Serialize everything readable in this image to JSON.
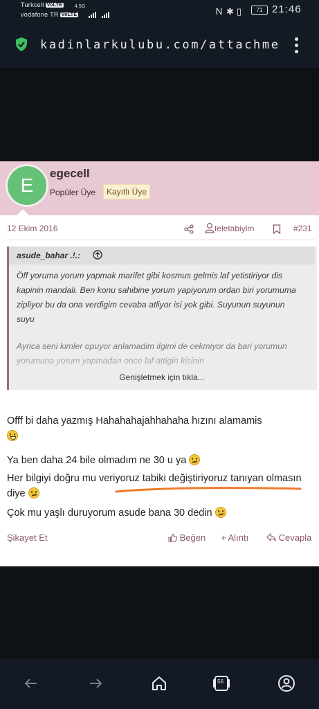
{
  "status_bar": {
    "carrier1": "Turkcell",
    "carrier2": "vodafone TR",
    "volte": "VoLTE",
    "network": "4.5G",
    "battery": "71",
    "time": "21:46"
  },
  "browser": {
    "url": "kadinlarkulubu.com/attachments/sc",
    "tab_count": "56"
  },
  "post": {
    "avatar_letter": "E",
    "username": "egecell",
    "user_title": "Popüler Üye",
    "user_badge": "Kayıtlı Üye",
    "date": "12 Ekim 2016",
    "user_link": "teletabiyim",
    "post_number": "#231",
    "quote": {
      "author": "asude_bahar .!.:",
      "text": "Öff yoruma yorum yapmak marifet gibi kosmus gelmis laf yetistiriyor dis kapinin mandali. Ben konu sahibine yorum yapiyorum ordan biri yorumuma zipliyor bu da ona verdigim cevaba atliyor isi yok gibi. Suyunun suyunun suyu",
      "faded_text": "Ayrica seni kimler opuyor anlamadim ilgimi de cekmiyor da bari yorumun yorumuna yorum yapmadan once laf attigin kisinin",
      "expand_label": "Genişletmek için tıkla..."
    },
    "body": {
      "line1": "Offf bi daha yazmış Hahahahajahhahaha hızını alamamis",
      "line2": "Ya ben daha 24 bile olmadım ne 30 u ya",
      "line3": "Her bilgiyi doğru mu veriyoruz tabiki değiştiriyoruz tanıyan olmasın diye",
      "line4": "Çok mu yaşlı duruyorum asude bana 30 dedin"
    },
    "actions": {
      "report": "Şikayet Et",
      "like": "Beğen",
      "quote": "+ Alıntı",
      "reply": "Cevapla"
    }
  },
  "colors": {
    "accent": "#8c5a6a",
    "header_bg": "#e8c8d2",
    "avatar_bg": "#64c176",
    "annotation": "#f07a2a"
  }
}
